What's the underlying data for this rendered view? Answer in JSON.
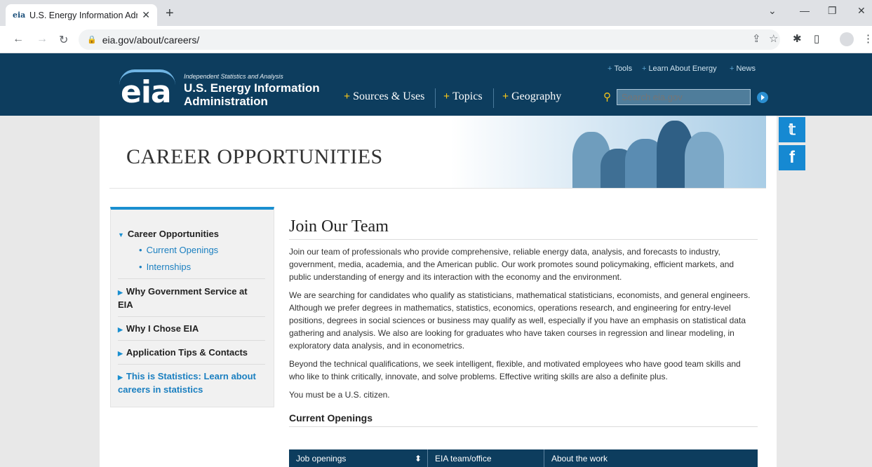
{
  "browser": {
    "tab_title": "U.S. Energy Information Administ",
    "tab_favicon": "eia",
    "url": "eia.gov/about/careers/"
  },
  "header": {
    "logo": "eia",
    "tagline": "Independent Statistics and Analysis",
    "org_line1": "U.S. Energy Information",
    "org_line2": "Administration",
    "top_links": [
      "Tools",
      "Learn About Energy",
      "News"
    ],
    "main_nav": [
      "Sources & Uses",
      "Topics",
      "Geography"
    ],
    "search_placeholder": "Search eia.gov"
  },
  "banner": {
    "title": "CAREER OPPORTUNITIES"
  },
  "sidebar": {
    "section": "Career Opportunities",
    "sub_links": [
      "Current Openings",
      "Internships"
    ],
    "items": [
      "Why Government Service at EIA",
      "Why I Chose EIA",
      "Application Tips & Contacts",
      "This is Statistics: Learn about careers in statistics"
    ]
  },
  "main": {
    "title": "Join Our Team",
    "paragraphs": [
      "Join our team of professionals who provide comprehensive, reliable energy data, analysis, and forecasts to industry, government, media, academia, and the American public. Our work promotes sound policymaking, efficient markets, and public understanding of energy and its interaction with the economy and the environment.",
      "We are searching for candidates who qualify as statisticians, mathematical statisticians, economists, and general engineers. Although we prefer degrees in mathematics, statistics, economics, operations research, and engineering for entry-level positions, degrees in social sciences or business may qualify as well, especially if you have an emphasis on statistical data gathering and analysis. We also are looking for graduates who have taken courses in regression and linear modeling, in exploratory data analysis, and in econometrics.",
      "Beyond the technical qualifications, we seek intelligent, flexible, and motivated employees who have good team skills and who like to think critically, innovate, and solve problems. Effective writing skills are also a definite plus.",
      "You must be a U.S. citizen."
    ],
    "openings_heading": "Current Openings",
    "table_headers": [
      "Job openings",
      "EIA team/office",
      "About the work"
    ]
  },
  "colors": {
    "header_bg": "#0d3d5e",
    "accent": "#1a8fd0",
    "nav_plus": "#f5c518"
  }
}
